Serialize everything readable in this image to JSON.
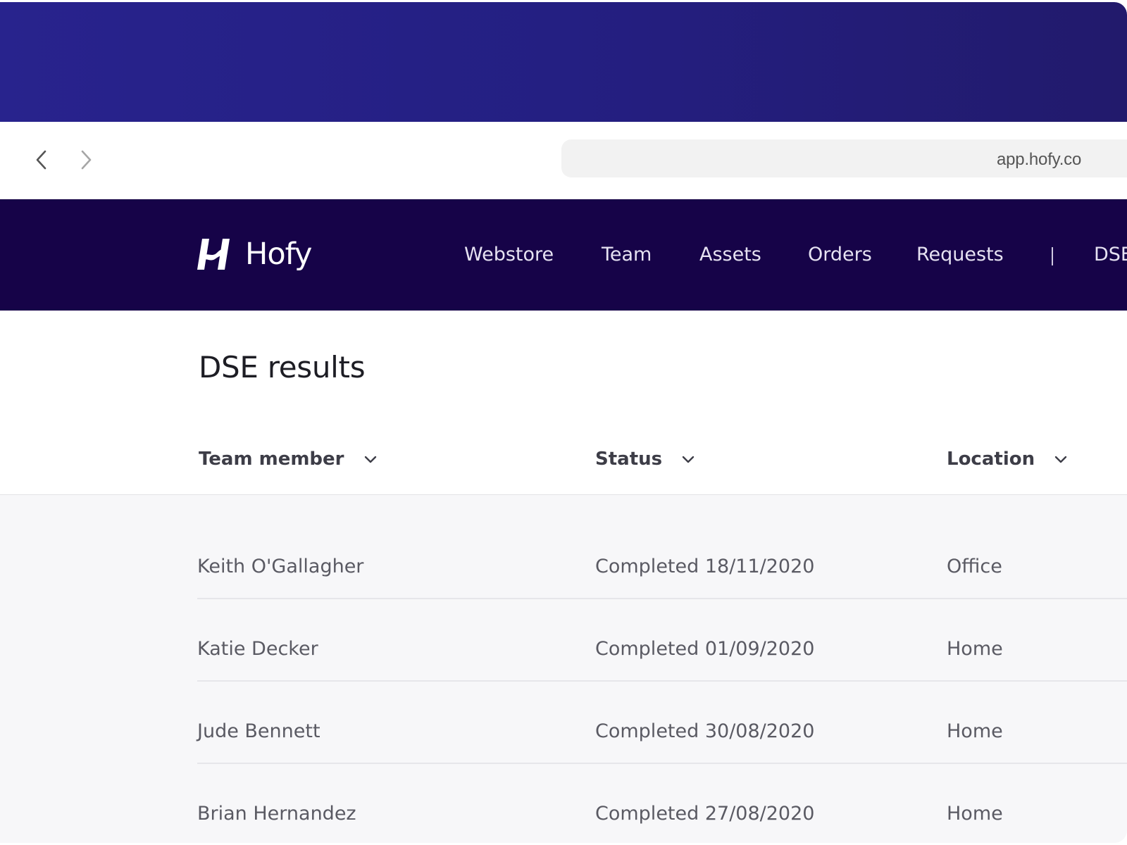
{
  "browser": {
    "url": "app.hofy.co",
    "back_icon": "chevron-left-icon",
    "forward_icon": "chevron-right-icon"
  },
  "header": {
    "logo_text": "Hofy",
    "nav": [
      {
        "label": "Webstore"
      },
      {
        "label": "Team"
      },
      {
        "label": "Assets"
      },
      {
        "label": "Orders"
      },
      {
        "label": "Requests"
      },
      {
        "label": "DSE"
      }
    ]
  },
  "page": {
    "title": "DSE results"
  },
  "table": {
    "columns": [
      {
        "label": "Team member"
      },
      {
        "label": "Status"
      },
      {
        "label": "Location"
      }
    ],
    "rows": [
      {
        "member": "Keith O'Gallagher",
        "status": "Completed 18/11/2020",
        "location": "Office"
      },
      {
        "member": "Katie Decker",
        "status": "Completed 01/09/2020",
        "location": "Home"
      },
      {
        "member": "Jude Bennett",
        "status": "Completed 30/08/2020",
        "location": "Home"
      },
      {
        "member": "Brian Hernandez",
        "status": "Completed 27/08/2020",
        "location": "Home"
      }
    ]
  },
  "colors": {
    "titlebar": "#28238d",
    "header_bg": "#160348",
    "row_bg": "#f7f7f9",
    "text_primary": "#1d1d24",
    "text_secondary": "#5a5a63"
  }
}
